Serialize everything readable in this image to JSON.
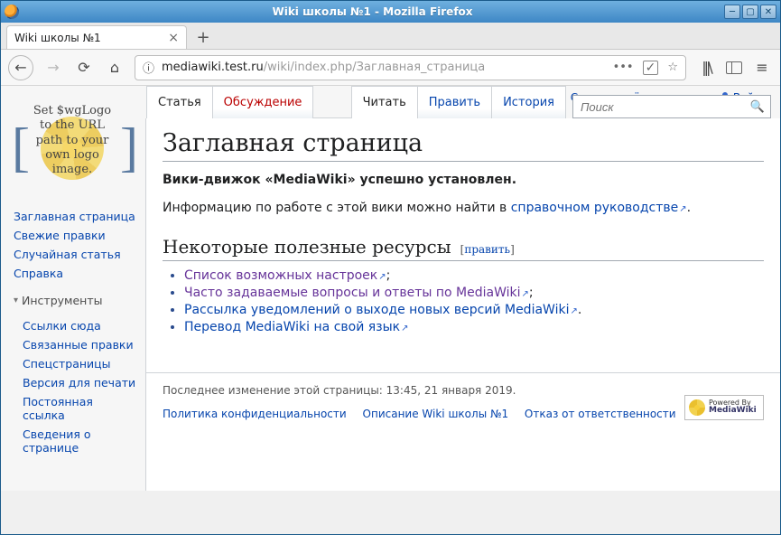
{
  "window": {
    "title": "Wiki школы №1 - Mozilla Firefox"
  },
  "browser_tab": {
    "title": "Wiki школы №1"
  },
  "url": {
    "info_glyph": "ⓘ",
    "host": "mediawiki.test.ru",
    "path": "/wiki/index.php/Заглавная_страница"
  },
  "userlinks": {
    "create": "Создать учётную запись",
    "login": "Войти"
  },
  "logo": {
    "line1": "Set $wgLogo",
    "line2": "to the URL",
    "line3": "path to your",
    "line4": "own logo",
    "line5": "image."
  },
  "sidebar": {
    "nav": [
      "Заглавная страница",
      "Свежие правки",
      "Случайная статья",
      "Справка"
    ],
    "tools_heading": "Инструменты",
    "tools": [
      "Ссылки сюда",
      "Связанные правки",
      "Спецстраницы",
      "Версия для печати",
      "Постоянная ссылка",
      "Сведения о странице"
    ]
  },
  "ptabs": {
    "left": {
      "article": "Статья",
      "talk": "Обсуждение"
    },
    "right": {
      "read": "Читать",
      "edit": "Править",
      "history": "История"
    },
    "search_placeholder": "Поиск"
  },
  "article": {
    "heading": "Заглавная страница",
    "installed": "Вики-движок «MediaWiki» успешно установлен.",
    "info_prefix": "Информацию по работе с этой вики можно найти в ",
    "info_link": "справочном руководстве",
    "info_suffix": ".",
    "resources_heading": "Некоторые полезные ресурсы",
    "editsec_label": "править",
    "resources": [
      {
        "text": "Список возможных настроек",
        "trail": ";",
        "visited": true
      },
      {
        "text": "Часто задаваемые вопросы и ответы по MediaWiki",
        "trail": ";",
        "visited": true
      },
      {
        "text": "Рассылка уведомлений о выходе новых версий MediaWiki",
        "trail": ".",
        "visited": false
      },
      {
        "text": "Перевод MediaWiki на свой язык",
        "trail": "",
        "visited": false
      }
    ]
  },
  "footer": {
    "lastmod": "Последнее изменение этой страницы: 13:45, 21 января 2019.",
    "privacy": "Политика конфиденциальности",
    "about": "Описание Wiki школы №1",
    "disclaimer": "Отказ от ответственности",
    "powered_top": "Powered By",
    "powered_bottom": "MediaWiki"
  }
}
